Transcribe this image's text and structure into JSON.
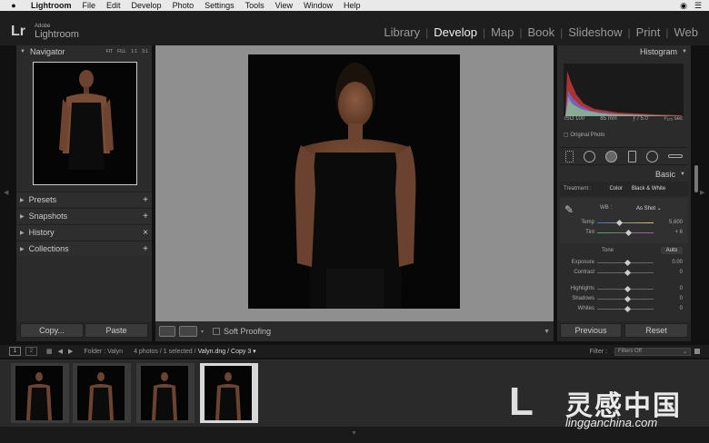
{
  "menubar": {
    "app": "Lightroom",
    "items": [
      "File",
      "Edit",
      "Develop",
      "Photo",
      "Settings",
      "Tools",
      "View",
      "Window",
      "Help"
    ]
  },
  "identity": {
    "mark": "Lr",
    "adobe": "Adobe",
    "name": "Lightroom"
  },
  "modules": {
    "items": [
      "Library",
      "Develop",
      "Map",
      "Book",
      "Slideshow",
      "Print",
      "Web"
    ],
    "active": "Develop"
  },
  "left": {
    "navigator": "Navigator",
    "zoom": [
      "FIT",
      "FILL",
      "1:1",
      "3:1"
    ],
    "sections": [
      {
        "label": "Presets",
        "action": "+"
      },
      {
        "label": "Snapshots",
        "action": "+"
      },
      {
        "label": "History",
        "action": "×"
      },
      {
        "label": "Collections",
        "action": "+"
      }
    ],
    "copy": "Copy...",
    "paste": "Paste"
  },
  "toolbar": {
    "soft_proofing": "Soft Proofing"
  },
  "right": {
    "histogram": "Histogram",
    "iso": "ISO 100",
    "focal": "85 mm",
    "aperture": "ƒ / 5.0",
    "shutter": "¹⁄₁₂₅ sec",
    "original_photo": "Original Photo",
    "basic": "Basic",
    "treatment_label": "Treatment :",
    "color": "Color",
    "bw": "Black & White",
    "wb_label": "WB :",
    "wb_value": "As Shot",
    "temp": {
      "label": "Temp",
      "value": "5,600",
      "pos": 0.35
    },
    "tint": {
      "label": "Tint",
      "value": "+ 6",
      "pos": 0.52
    },
    "tone_label": "Tone",
    "auto": "Auto",
    "sliders": [
      {
        "label": "Exposure",
        "value": "0.00",
        "pos": 0.5
      },
      {
        "label": "Contrast",
        "value": "0",
        "pos": 0.5
      },
      {
        "label": "Highlights",
        "value": "0",
        "pos": 0.5
      },
      {
        "label": "Shadows",
        "value": "0",
        "pos": 0.5
      },
      {
        "label": "Whites",
        "value": "0",
        "pos": 0.5
      }
    ],
    "previous": "Previous",
    "reset": "Reset"
  },
  "filmstrip": {
    "page1": "1",
    "page2": "2",
    "folder": "Folder : Valyn",
    "count": "4 photos / 1 selected /",
    "filename": "Valyn.dng / Copy 3",
    "filter_label": "Filter :",
    "filter_value": "Filters Off"
  },
  "watermark": {
    "cn": "灵感中国",
    "url": "lingganchina.com"
  }
}
